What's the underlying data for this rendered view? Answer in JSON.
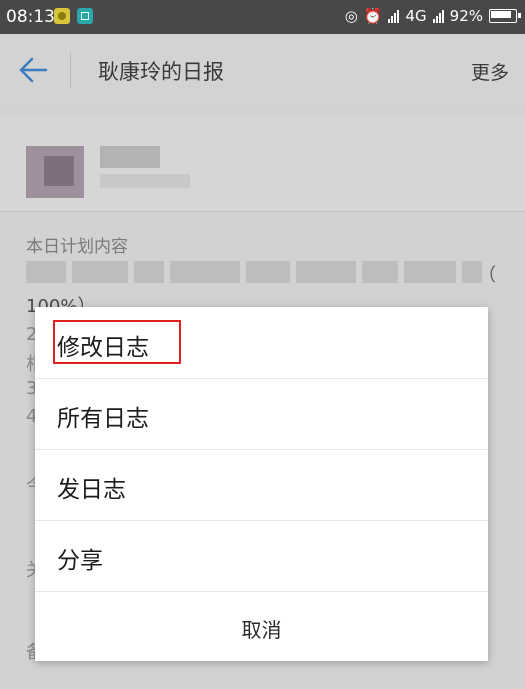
{
  "status_bar": {
    "time": "08:13",
    "network_label": "4G",
    "battery": "92%",
    "location_icon": "location-icon",
    "alarm_icon": "alarm-icon"
  },
  "app_bar": {
    "title": "耿康玲的日报",
    "more": "更多",
    "back_icon": "back-arrow-icon"
  },
  "content": {
    "section_label": "本日计划内容",
    "paren": "（",
    "percent": "100%）",
    "ghost_chars": [
      "2",
      "相",
      "3",
      "4",
      "今",
      "关",
      "备"
    ]
  },
  "dialog": {
    "items": [
      {
        "label": "修改日志",
        "highlighted": true
      },
      {
        "label": "所有日志"
      },
      {
        "label": "发日志"
      },
      {
        "label": "分享"
      }
    ],
    "cancel": "取消",
    "highlight_color": "#e02020"
  }
}
